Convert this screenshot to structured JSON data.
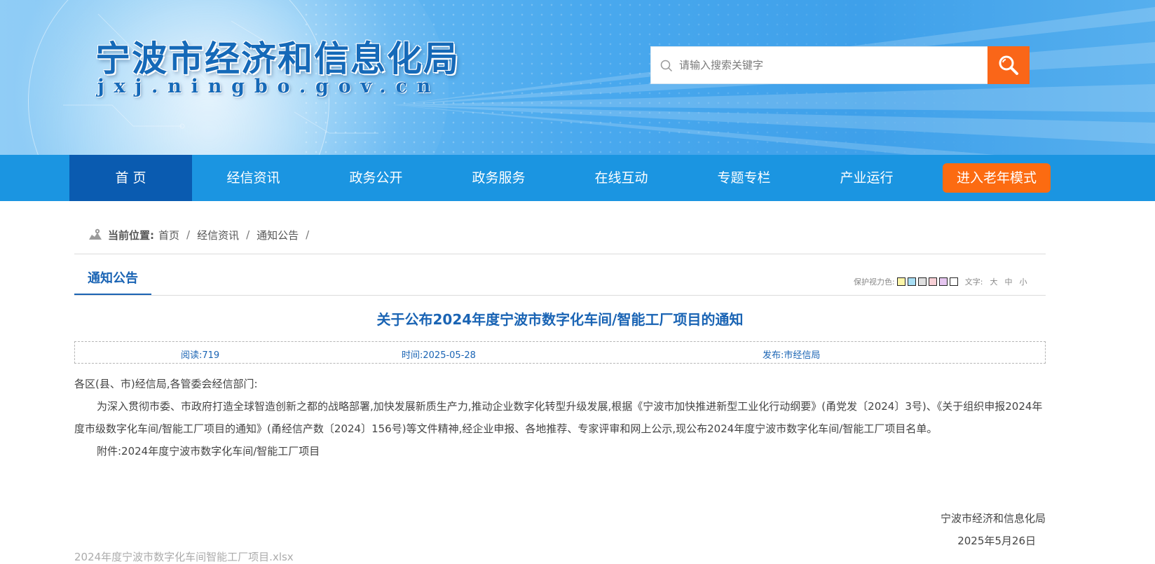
{
  "header": {
    "title": "宁波市经济和信息化局",
    "domain": "jxj.ningbo.gov.cn",
    "search_placeholder": "请输入搜索关键字",
    "search_icon": "search-icon",
    "accent_color": "#fa6618"
  },
  "nav": {
    "items": [
      "首 页",
      "经信资讯",
      "政务公开",
      "政务服务",
      "在线互动",
      "专题专栏",
      "产业运行"
    ],
    "active_index": 0,
    "elder_mode": "进入老年模式",
    "bar_color": "#1b95e1",
    "active_color": "#0a5bb0",
    "elder_color": "#fc6b11"
  },
  "breadcrumb": {
    "label": "当前位置:",
    "items": [
      "首页",
      "经信资讯",
      "通知公告"
    ],
    "separator": "/"
  },
  "section": {
    "tab": "通知公告",
    "eye_protect_label": "保护视力色:",
    "swatches": [
      "#fdf6a8",
      "#a9dff5",
      "#e0e0e0",
      "#f8d0d6",
      "#e6c6f0",
      "#ffffff"
    ],
    "font_label": "文字:",
    "font_sizes": [
      "大",
      "中",
      "小"
    ]
  },
  "article": {
    "title": "关于公布2024年度宁波市数字化车间/智能工厂项目的通知",
    "reads": "阅读:719",
    "time": "时间:2025-05-28",
    "publisher": "发布:市经信局",
    "salutation": "各区(县、市)经信局,各管委会经信部门:",
    "paragraph": "为深入贯彻市委、市政府打造全球智造创新之都的战略部署,加快发展新质生产力,推动企业数字化转型升级发展,根据《宁波市加快推进新型工业化行动纲要》(甬党发〔2024〕3号)、《关于组织申报2024年度市级数字化车间/智能工厂项目的通知》(甬经信产数〔2024〕156号)等文件精神,经企业申报、各地推荐、专家评审和网上公示,现公布2024年度宁波市数字化车间/智能工厂项目名单。",
    "attachment": "附件:2024年度宁波市数字化车间/智能工厂项目",
    "signature": "宁波市经济和信息化局",
    "date": "2025年5月26日",
    "attachment_link": "2024年度宁波市数字化车间智能工厂项目.xlsx"
  }
}
